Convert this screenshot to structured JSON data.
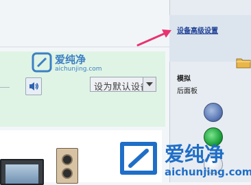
{
  "side_panel": {
    "device_advanced_link": "设备高级设置",
    "title": "模拟",
    "subtitle": "后面板"
  },
  "main": {
    "set_default_label": "设为默认设备"
  },
  "watermark": {
    "brand_cn": "爱纯净",
    "brand_en": "aichunjing.com"
  },
  "icons": [
    "speaker-icon",
    "folder-icon",
    "annotation-arrow-icon",
    "logo-icon"
  ],
  "colors": {
    "link": "#1c3f94",
    "panel_green": "#dff4e5",
    "arrow": "#e8336f",
    "brand": "#1f6ec7"
  }
}
